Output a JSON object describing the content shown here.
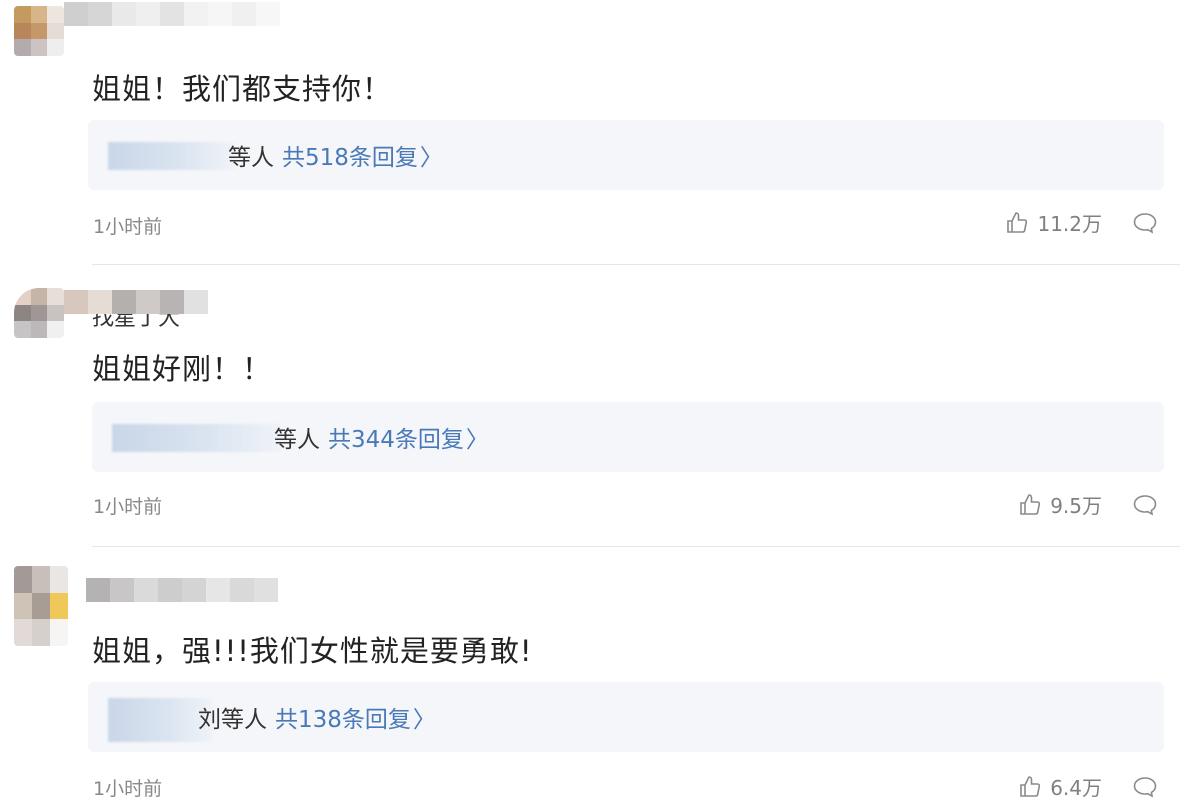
{
  "comments": [
    {
      "text": "姐姐！我们都支持你！",
      "reply_who": "等人",
      "reply_count": "共518条回复",
      "reply_arrow": "〉",
      "time": "1小时前",
      "likes": "11.2万",
      "avatar_colors": [
        "#c59a5e",
        "#d7b489",
        "#ece6df",
        "#b8865a",
        "#c49868",
        "#e4ddd6",
        "#b4abad",
        "#ccc3c2",
        "#eee"
      ],
      "name_colors": [
        "#cfcfcf",
        "#d6d6d6",
        "#e9e9e9",
        "#efefef",
        "#e3e3e3",
        "#f2f2f2",
        "#f6f6f6",
        "#f0f0f0",
        "#f7f7f7"
      ]
    },
    {
      "partial_name": "找星丁大",
      "text": "姐姐好刚！！",
      "reply_who": "等人",
      "reply_count": "共344条回复",
      "reply_arrow": "〉",
      "time": "1小时前",
      "likes": "9.5万",
      "avatar_colors": [
        "#e4d0c4",
        "#c6b4a6",
        "#e6dfd9",
        "#8c8582",
        "#9e9795",
        "#c8c3c1",
        "#c7c4c5",
        "#bcb8b9",
        "#f1f0f0"
      ],
      "name_colors": [
        "#d7c7bd",
        "#e4dcd5",
        "#b3b0ae",
        "#cfcac7",
        "#b7b4b3",
        "#e1e1e1"
      ]
    },
    {
      "text": "姐姐，强!!!我们女性就是要勇敢!",
      "reply_who": "刘等人",
      "reply_count": "共138条回复",
      "reply_arrow": "〉",
      "time": "1小时前",
      "likes": "6.4万",
      "avatar_colors": [
        "#a39a97",
        "#c9bfba",
        "#e9e6e4",
        "#cfc3b8",
        "#a79d95",
        "#f0c85a",
        "#e2dad6",
        "#d6d0cc",
        "#f6f5f4"
      ],
      "name_colors": [
        "#b4b2b2",
        "#c8c6c6",
        "#dadada",
        "#cdcdcd",
        "#d4d4d4",
        "#e6e6e6",
        "#d9d9d9",
        "#e0e0e0"
      ]
    }
  ]
}
